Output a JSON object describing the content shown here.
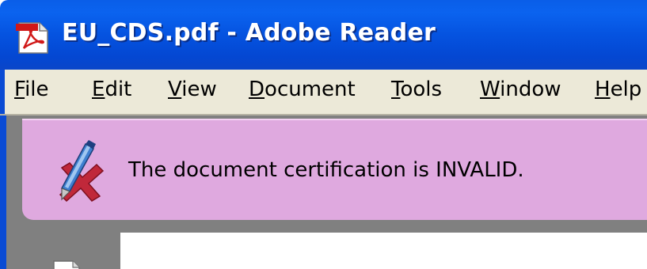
{
  "window": {
    "title": "EU_CDS.pdf - Adobe Reader",
    "app_icon": "adobe-reader-pdf-icon",
    "colors": {
      "titlebar": "#0553e0",
      "menubar": "#ece9d8",
      "certbar": "#dfa9df",
      "backdrop": "#808080"
    }
  },
  "menubar": {
    "items": [
      {
        "label": "File",
        "accel": "F",
        "rest": "ile"
      },
      {
        "label": "Edit",
        "accel": "E",
        "rest": "dit"
      },
      {
        "label": "View",
        "accel": "V",
        "rest": "iew"
      },
      {
        "label": "Document",
        "accel": "D",
        "rest": "ocument"
      },
      {
        "label": "Tools",
        "accel": "T",
        "rest": "ools"
      },
      {
        "label": "Window",
        "accel": "W",
        "rest": "indow"
      },
      {
        "label": "Help",
        "accel": "H",
        "rest": "elp"
      }
    ]
  },
  "certification_bar": {
    "icon": "invalid-signature-pen-icon",
    "message": "The document certification is INVALID."
  },
  "pages_panel": {
    "icon": "page-thumbnail-icon"
  }
}
